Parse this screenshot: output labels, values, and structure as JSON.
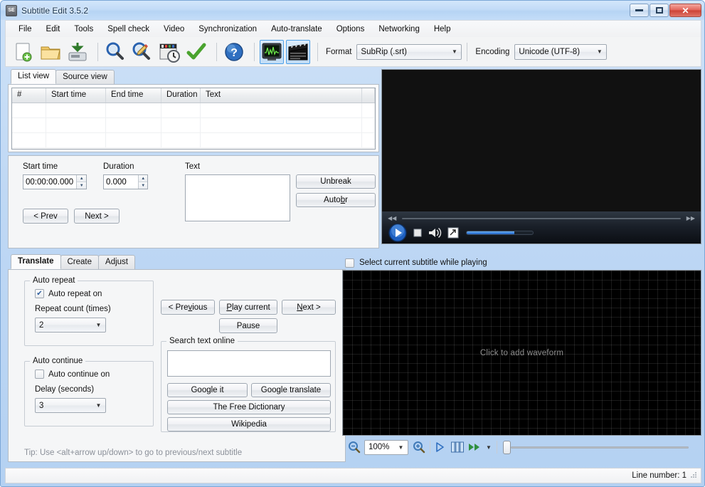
{
  "window": {
    "title": "Subtitle Edit 3.5.2",
    "app_icon": "SE",
    "minimize_label": "Minimize",
    "maximize_label": "Maximize",
    "close_label": "✕"
  },
  "menubar": {
    "items": [
      {
        "label": "File"
      },
      {
        "label": "Edit"
      },
      {
        "label": "Tools"
      },
      {
        "label": "Spell check"
      },
      {
        "label": "Video"
      },
      {
        "label": "Synchronization"
      },
      {
        "label": "Auto-translate"
      },
      {
        "label": "Options"
      },
      {
        "label": "Networking"
      },
      {
        "label": "Help"
      }
    ]
  },
  "toolbar": {
    "icons": [
      {
        "name": "new-file-icon",
        "title": "New"
      },
      {
        "name": "open-folder-icon",
        "title": "Open"
      },
      {
        "name": "save-icon",
        "title": "Save"
      },
      {
        "name": "find-icon",
        "title": "Find"
      },
      {
        "name": "replace-icon",
        "title": "Replace"
      },
      {
        "name": "sync-clock-icon",
        "title": "Visual sync"
      },
      {
        "name": "checkmark-icon",
        "title": "Spell check"
      },
      {
        "name": "help-icon",
        "title": "Help"
      }
    ],
    "toggles": [
      {
        "name": "waveform-toggle",
        "title": "Waveform",
        "active": true
      },
      {
        "name": "video-toggle",
        "title": "Video",
        "active": true
      }
    ],
    "format_label": "Format",
    "format_value": "SubRip (.srt)",
    "encoding_label": "Encoding",
    "encoding_value": "Unicode (UTF-8)"
  },
  "subtitle_panel": {
    "tabs": [
      {
        "label": "List view",
        "active": true
      },
      {
        "label": "Source view",
        "active": false
      }
    ],
    "grid": {
      "columns": [
        "#",
        "Start time",
        "End time",
        "Duration",
        "Text"
      ],
      "rows": []
    },
    "editor": {
      "start_time_label": "Start time",
      "start_time_value": "00:00:00.000",
      "duration_label": "Duration",
      "duration_value": "0.000",
      "text_label": "Text",
      "text_value": "",
      "prev_label": "< Prev",
      "next_label": "Next >",
      "unbreak_label": "Unbreak",
      "autobr_label_pre": "Auto ",
      "autobr_label_mnemonic": "b",
      "autobr_label_post": "r"
    }
  },
  "bottom_panel": {
    "tabs": [
      {
        "label": "Translate",
        "active": true
      },
      {
        "label": "Create",
        "active": false
      },
      {
        "label": "Adjust",
        "active": false
      }
    ],
    "auto_repeat": {
      "group_title": "Auto repeat",
      "checkbox_label": "Auto repeat on",
      "checkbox_checked": true,
      "count_label": "Repeat count (times)",
      "count_value": "2"
    },
    "auto_continue": {
      "group_title": "Auto continue",
      "checkbox_label": "Auto continue on",
      "checkbox_checked": false,
      "delay_label": "Delay (seconds)",
      "delay_value": "3"
    },
    "playback": {
      "previous_pre": "< Pre",
      "previous_mnemonic": "v",
      "previous_post": "ious",
      "play_current_mnemonic": "P",
      "play_current_post": "lay current",
      "next_mnemonic": "N",
      "next_post": "ext >",
      "pause_label": "Pause"
    },
    "search_online": {
      "group_title": "Search text online",
      "input_value": "",
      "google_it_label": "Google it",
      "google_translate_label": "Google translate",
      "free_dictionary_label": "The Free Dictionary",
      "wikipedia_label": "Wikipedia"
    },
    "tip": "Tip: Use <alt+arrow up/down> to go to previous/next subtitle"
  },
  "video": {
    "select_subtitle_label": "Select current subtitle while playing",
    "select_subtitle_checked": false,
    "controls": {
      "rewind_icon": "◀◀",
      "forward_icon": "▶▶",
      "play_label": "Play",
      "stop_label": "Stop",
      "volume_label": "Volume",
      "fullscreen_label": "Fullscreen"
    }
  },
  "waveform": {
    "placeholder": "Click to add waveform",
    "zoom_out_label": "Zoom out",
    "zoom_value": "100%",
    "zoom_in_label": "Zoom in",
    "play_label": "Play",
    "frames_label": "Show frames",
    "speed_label": "Playback speed"
  },
  "statusbar": {
    "line_number": "Line number: 1"
  }
}
